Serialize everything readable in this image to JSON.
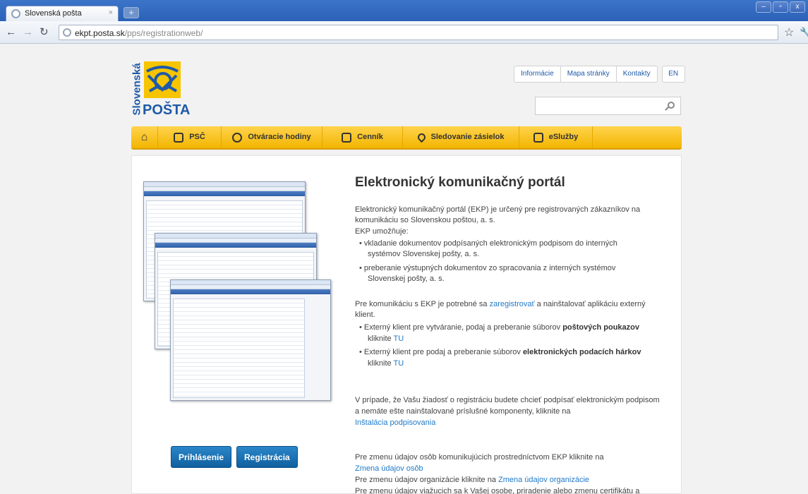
{
  "browser": {
    "tab_title": "Slovenská pošta",
    "tab_close": "×",
    "newtab_label": "+",
    "window_buttons": [
      "–",
      "▫",
      "x"
    ],
    "url_host": "ekpt.posta.sk",
    "url_path": "/pps/registrationweb/"
  },
  "header": {
    "logo_vertical": "Slovenská",
    "logo_text": "POŠTA",
    "top_links": [
      "Informácie",
      "Mapa stránky",
      "Kontakty"
    ],
    "lang": "EN",
    "search_value": ""
  },
  "menu": {
    "items": [
      "PSČ",
      "Otváracie hodiny",
      "Cenník",
      "Sledovanie zásielok",
      "eSlužby"
    ]
  },
  "buttons": {
    "login": "Prihlásenie",
    "register": "Registrácia"
  },
  "main": {
    "title": "Elektronický komunikačný portál",
    "intro1": "Elektronický komunikačný portál (EKP) je určený pre registrovaných zákazníkov na",
    "intro2": "komunikáciu so Slovenskou poštou, a. s.",
    "enables": "EKP umožňuje:",
    "bullet1a": "• vkladanie dokumentov podpísaných elektronickým podpisom do interných",
    "bullet1b": "systémov Slovenskej pošty, a. s.",
    "bullet2a": "• preberanie výstupných dokumentov zo spracovania z interných systémov",
    "bullet2b": "Slovenskej pošty, a. s.",
    "comm_pre": "Pre komunikáciu s EKP je potrebné sa ",
    "comm_link": "zaregistrovať",
    "comm_post": " a nainštalovať aplikáciu externý",
    "comm_line2": "klient.",
    "ext1_pre": "• Externý klient pre vytváranie, podaj a preberanie súborov ",
    "ext1_bold": "poštových poukazov",
    "ext1_line2": "kliknite ",
    "ext1_link": "TU",
    "ext2_pre": "• Externý klient pre podaj a preberanie súborov ",
    "ext2_bold": "elektronických podacích hárkov",
    "ext2_line2": "kliknite ",
    "ext2_link": "TU",
    "sign1": "V prípade, že Vašu žiadosť o registráciu budete chcieť podpísať elektronickým podpisom",
    "sign2": "a nemáte ešte nainštalované príslušné komponenty, kliknite na",
    "sign_link": "Inštalácia podpisovania",
    "change1": "Pre zmenu údajov osôb komunikujúcich prostredníctvom EKP kliknite na",
    "change1_link": "Zmena údajov osôb",
    "change2_pre": "Pre zmenu údajov organizácie kliknite na ",
    "change2_link": "Zmena údajov organizácie",
    "change3": "Pre zmenu údajov viažucich sa k Vašej osobe, priradenie alebo zmenu certifikátu a"
  }
}
